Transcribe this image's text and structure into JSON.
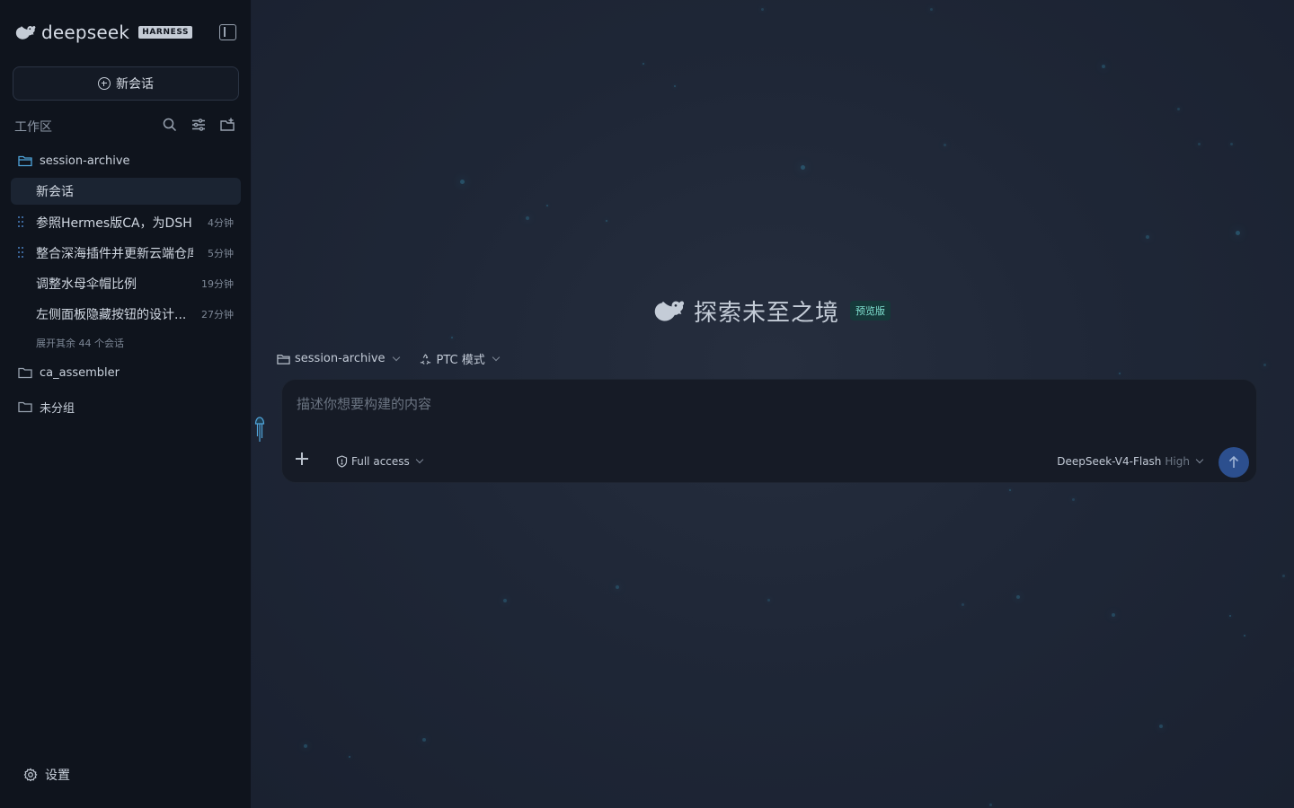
{
  "brand": {
    "name": "deepseek",
    "badge": "HARNESS"
  },
  "sidebar": {
    "new_chat_label": "新会话",
    "workspace_label": "工作区",
    "folders": [
      {
        "name": "session-archive",
        "expanded": true
      },
      {
        "name": "ca_assembler",
        "expanded": false
      },
      {
        "name": "未分组",
        "expanded": false
      }
    ],
    "chats": [
      {
        "title": "新会话",
        "time": "",
        "active": true
      },
      {
        "title": "参照Hermes版CA，为DSH...",
        "time": "4分钟",
        "running": true
      },
      {
        "title": "整合深海插件并更新云端仓库",
        "time": "5分钟",
        "running": true
      },
      {
        "title": "调整水母伞帽比例",
        "time": "19分钟"
      },
      {
        "title": "左侧面板隐藏按钮的设计...",
        "time": "27分钟"
      }
    ],
    "expand_more": "展开其余 44 个会话",
    "settings_label": "设置"
  },
  "main": {
    "hero_title": "探索未至之境",
    "hero_badge": "预览版",
    "context": {
      "folder": "session-archive",
      "mode": "PTC 模式"
    },
    "composer": {
      "placeholder": "描述你想要构建的内容",
      "value": "",
      "access_label": "Full access",
      "model": "DeepSeek-V4-Flash",
      "effort": "High"
    }
  },
  "colors": {
    "sidebar_bg": "#0f141d",
    "main_bg": "#1f2737",
    "accent_blue": "#2c4f8e",
    "badge_teal": "#7fe0d0",
    "drag_dot": "#4b82c4"
  },
  "icons": [
    "deepseek-whale-logo",
    "sidebar-toggle-icon",
    "plus-circle-icon",
    "search-icon",
    "filter-icon",
    "new-folder-icon",
    "folder-icon",
    "gear-icon",
    "shield-icon",
    "recycle-icon",
    "plus-icon",
    "arrow-up-icon",
    "jellyfish-icon"
  ]
}
